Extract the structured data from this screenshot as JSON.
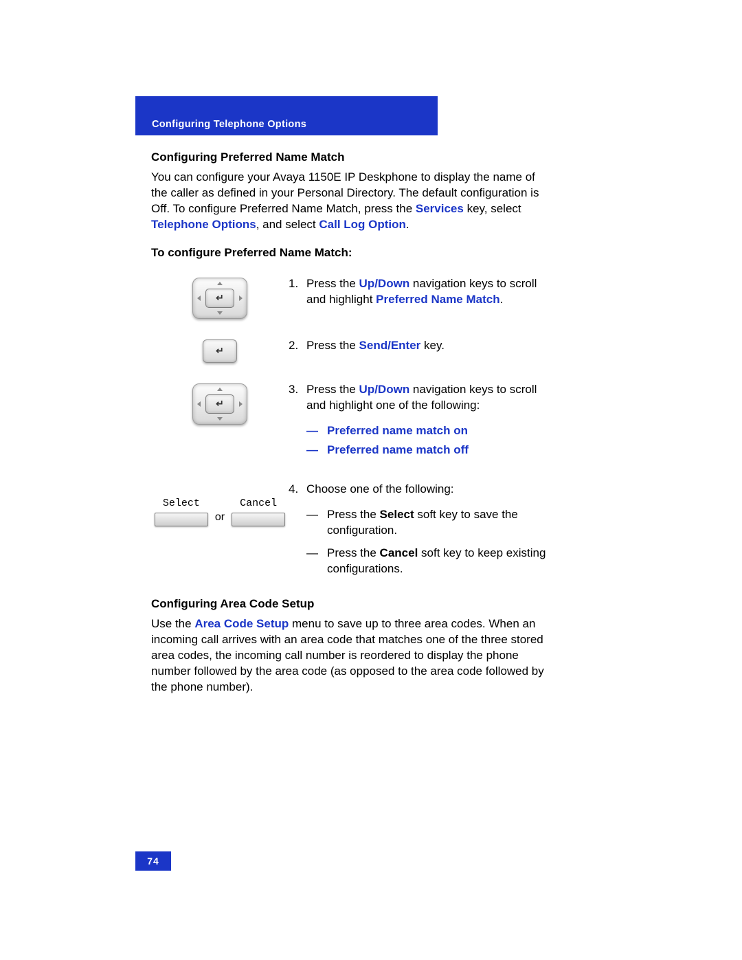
{
  "header": {
    "chapter": "Configuring Telephone Options"
  },
  "section1": {
    "heading": "Configuring Preferred Name Match",
    "intro_pre": "You can configure your Avaya 1150E IP Deskphone to display the name of the caller as defined in your Personal Directory. The default configuration is Off. To configure Preferred Name Match, press the ",
    "link1": "Services",
    "intro_mid1": " key, select ",
    "link2": "Telephone Options",
    "intro_mid2": ", and select ",
    "link3": "Call Log Option",
    "intro_end": ".",
    "subhead": "To configure Preferred Name Match:"
  },
  "steps": {
    "s1": {
      "num": "1.",
      "pre": "Press the ",
      "link1": "Up/Down",
      "mid": " navigation keys to scroll and highlight ",
      "link2": "Preferred Name Match",
      "end": "."
    },
    "s2": {
      "num": "2.",
      "pre": "Press the ",
      "link1": "Send/Enter",
      "end": " key."
    },
    "s3": {
      "num": "3.",
      "pre": "Press the ",
      "link1": "Up/Down",
      "end": " navigation keys to scroll and highlight one of the following:",
      "opt1": "Preferred name match on",
      "opt2": "Preferred name match off"
    },
    "s4": {
      "num": "4.",
      "lead": "Choose one of the following:",
      "a_pre": "Press the ",
      "a_link": "Select",
      "a_end": " soft key to save the configuration.",
      "b_pre": "Press the ",
      "b_link": "Cancel",
      "b_end": " soft key to keep existing configurations."
    }
  },
  "softkeys": {
    "select": "Select",
    "cancel": "Cancel",
    "or": "or"
  },
  "section2": {
    "heading": "Configuring Area Code Setup",
    "pre": "Use the ",
    "link1": "Area Code Setup",
    "end": " menu to save up to three area codes. When an incoming call arrives with an area code that matches one of the three stored area codes, the incoming call number is reordered to display the phone number followed by the area code (as opposed to the area code followed by the phone number)."
  },
  "footer": {
    "page": "74"
  },
  "dash": "—"
}
